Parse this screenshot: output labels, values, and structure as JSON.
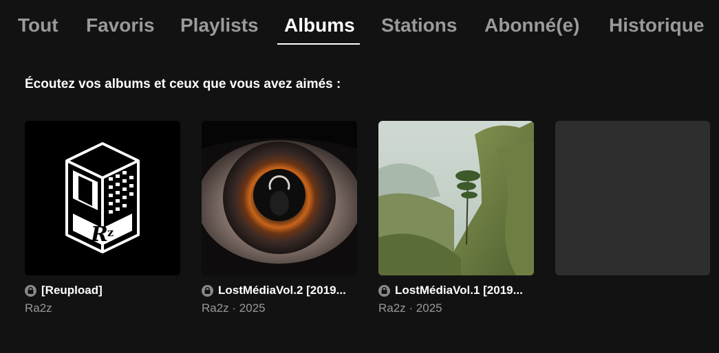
{
  "tabs": [
    {
      "label": "Tout",
      "active": false
    },
    {
      "label": "Favoris",
      "active": false
    },
    {
      "label": "Playlists",
      "active": false
    },
    {
      "label": "Albums",
      "active": true
    },
    {
      "label": "Stations",
      "active": false
    },
    {
      "label": "Abonné(e)",
      "active": false
    },
    {
      "label": "Historique",
      "active": false
    }
  ],
  "section": {
    "heading": "Écoutez vos albums et ceux que vous avez aimés :"
  },
  "albums": [
    {
      "title": "[Reupload]",
      "subtitle": "Ra2z",
      "cover": "logo-r2z",
      "locked": true
    },
    {
      "title": "LostMédiaVol.2 [2019...",
      "subtitle": "Ra2z · 2025",
      "cover": "eye",
      "locked": true
    },
    {
      "title": "LostMédiaVol.1 [2019...",
      "subtitle": "Ra2z · 2025",
      "cover": "landscape",
      "locked": true
    }
  ],
  "colors": {
    "background": "#121212",
    "text_active": "#ffffff",
    "text_muted": "#9a9a9a",
    "placeholder": "#2e2e2e"
  }
}
